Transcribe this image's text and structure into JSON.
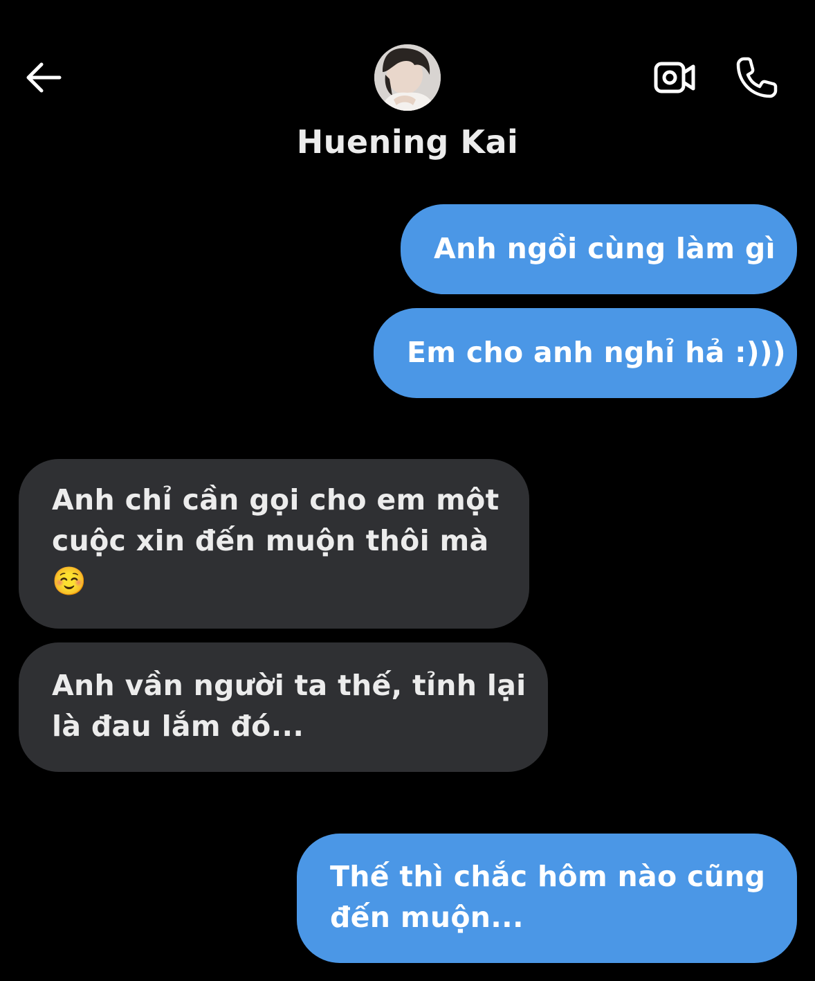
{
  "header": {
    "contact_name": "Huening Kai",
    "back_icon": "arrow-left-icon",
    "video_icon": "video-camera-icon",
    "call_icon": "phone-icon"
  },
  "messages": [
    {
      "direction": "sent",
      "text": "Anh ngồi cùng làm gì"
    },
    {
      "direction": "sent",
      "text": "Em cho anh nghỉ hả :)))"
    },
    {
      "direction": "received",
      "text": "Anh chỉ cần gọi cho em một cuộc xin đến muộn thôi mà",
      "emoji": "☺️"
    },
    {
      "direction": "received",
      "text": "Anh vần người ta thế, tỉnh lại là đau lắm đó..."
    },
    {
      "direction": "sent",
      "text": "Thế thì chắc hôm nào cũng đến muộn..."
    }
  ],
  "colors": {
    "background": "#000000",
    "sent_bubble": "#4b97e6",
    "received_bubble": "#2f3033",
    "text": "#ffffff"
  }
}
